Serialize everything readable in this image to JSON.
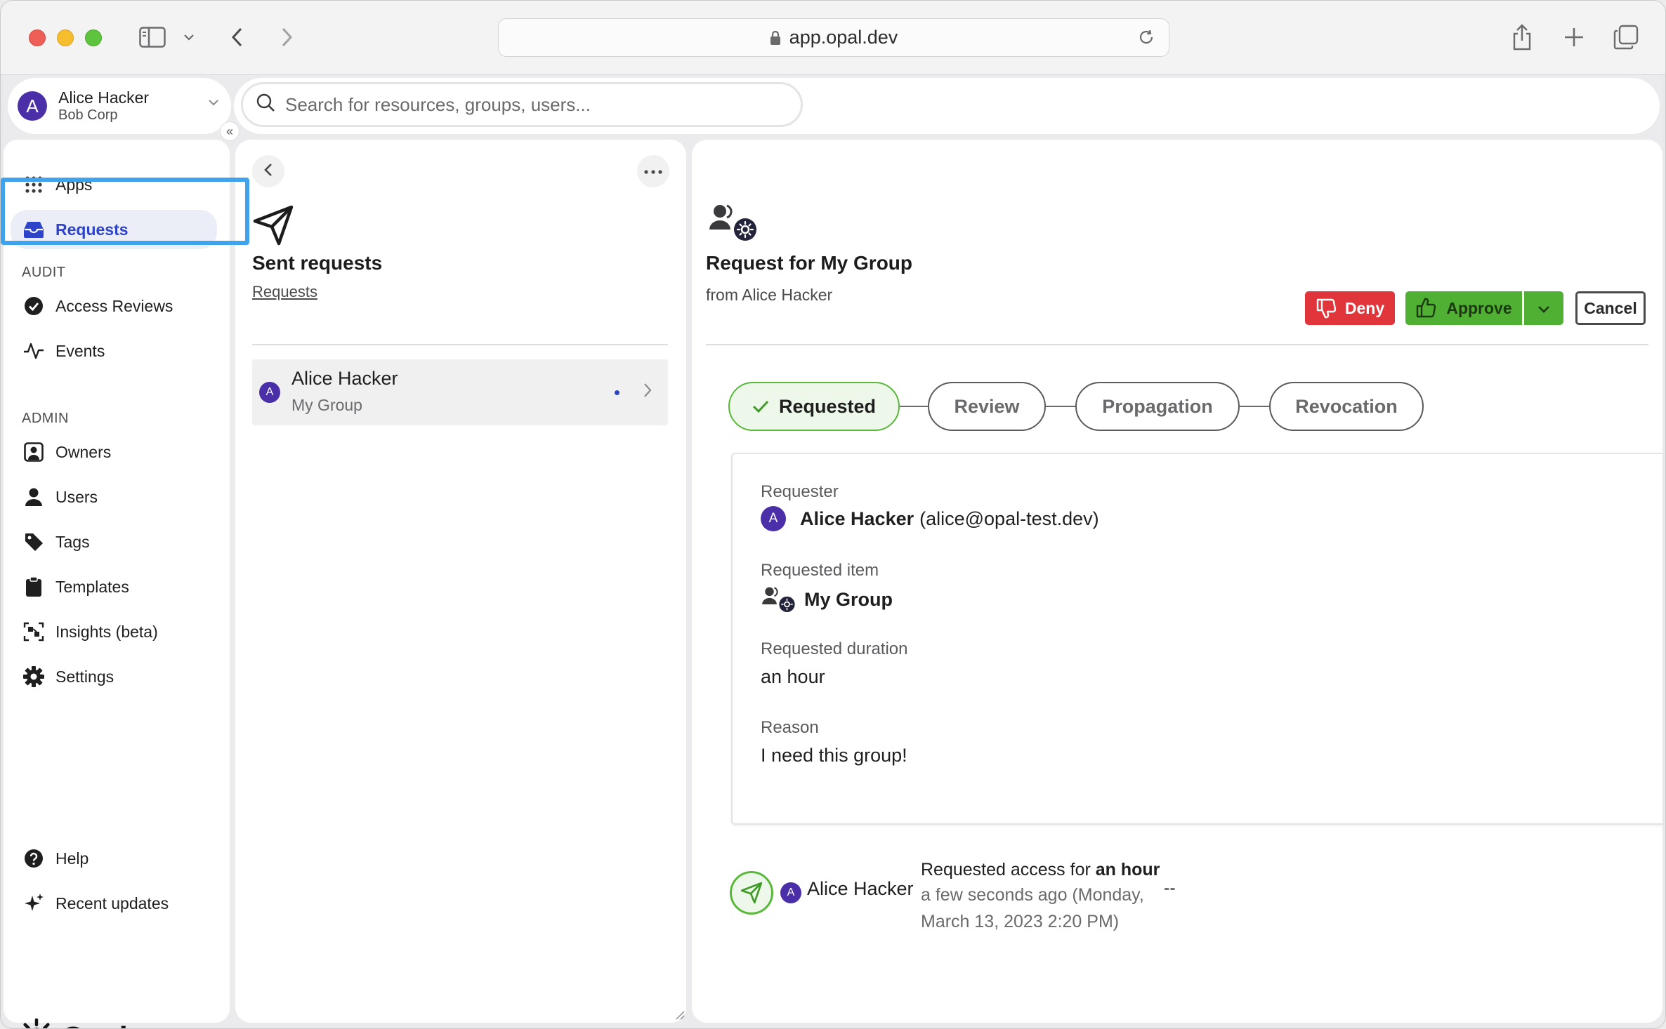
{
  "browser": {
    "url": "app.opal.dev"
  },
  "account": {
    "initial": "A",
    "name": "Alice Hacker",
    "org": "Bob Corp"
  },
  "search": {
    "placeholder": "Search for resources, groups, users..."
  },
  "sidebar": {
    "collapse_label": "«",
    "items_top": [
      {
        "label": "Apps",
        "icon": "grid-icon"
      },
      {
        "label": "Requests",
        "icon": "inbox-icon",
        "active": true
      }
    ],
    "audit_heading": "AUDIT",
    "audit_items": [
      {
        "label": "Access Reviews",
        "icon": "check-circle-icon"
      },
      {
        "label": "Events",
        "icon": "activity-icon"
      }
    ],
    "admin_heading": "ADMIN",
    "admin_items": [
      {
        "label": "Owners",
        "icon": "owner-icon"
      },
      {
        "label": "Users",
        "icon": "user-icon"
      },
      {
        "label": "Tags",
        "icon": "tag-icon"
      },
      {
        "label": "Templates",
        "icon": "clipboard-icon"
      },
      {
        "label": "Insights (beta)",
        "icon": "insights-icon"
      },
      {
        "label": "Settings",
        "icon": "gear-icon"
      }
    ],
    "bottom_items": [
      {
        "label": "Help",
        "icon": "help-icon"
      },
      {
        "label": "Recent updates",
        "icon": "sparkle-icon"
      }
    ],
    "logo_text": "Opal"
  },
  "middle": {
    "title": "Sent requests",
    "breadcrumb": "Requests",
    "requests": [
      {
        "initial": "A",
        "name": "Alice Hacker",
        "item": "My Group",
        "unread": true
      }
    ]
  },
  "detail": {
    "title": "Request for My Group",
    "from": "from Alice Hacker",
    "actions": {
      "deny": "Deny",
      "approve": "Approve",
      "cancel": "Cancel"
    },
    "steps": [
      {
        "label": "Requested",
        "done": true
      },
      {
        "label": "Review",
        "done": false
      },
      {
        "label": "Propagation",
        "done": false
      },
      {
        "label": "Revocation",
        "done": false
      }
    ],
    "fields": {
      "requester_label": "Requester",
      "requester_initial": "A",
      "requester_name": "Alice Hacker",
      "requester_email": "(alice@opal-test.dev)",
      "item_label": "Requested item",
      "item_value": "My Group",
      "duration_label": "Requested duration",
      "duration_value": "an hour",
      "reason_label": "Reason",
      "reason_value": "I need this group!"
    },
    "event": {
      "initial": "A",
      "actor": "Alice Hacker",
      "message_prefix": "Requested access for ",
      "message_bold": "an hour",
      "time": "a few seconds ago (Monday, March 13, 2023 2:20 PM)",
      "extra": "--"
    }
  },
  "colors": {
    "accent": "#2d44c9",
    "avatar": "#4a2fa8",
    "deny": "#e0353b",
    "approve": "#4fb034",
    "highlight": "#3fa3ec"
  }
}
